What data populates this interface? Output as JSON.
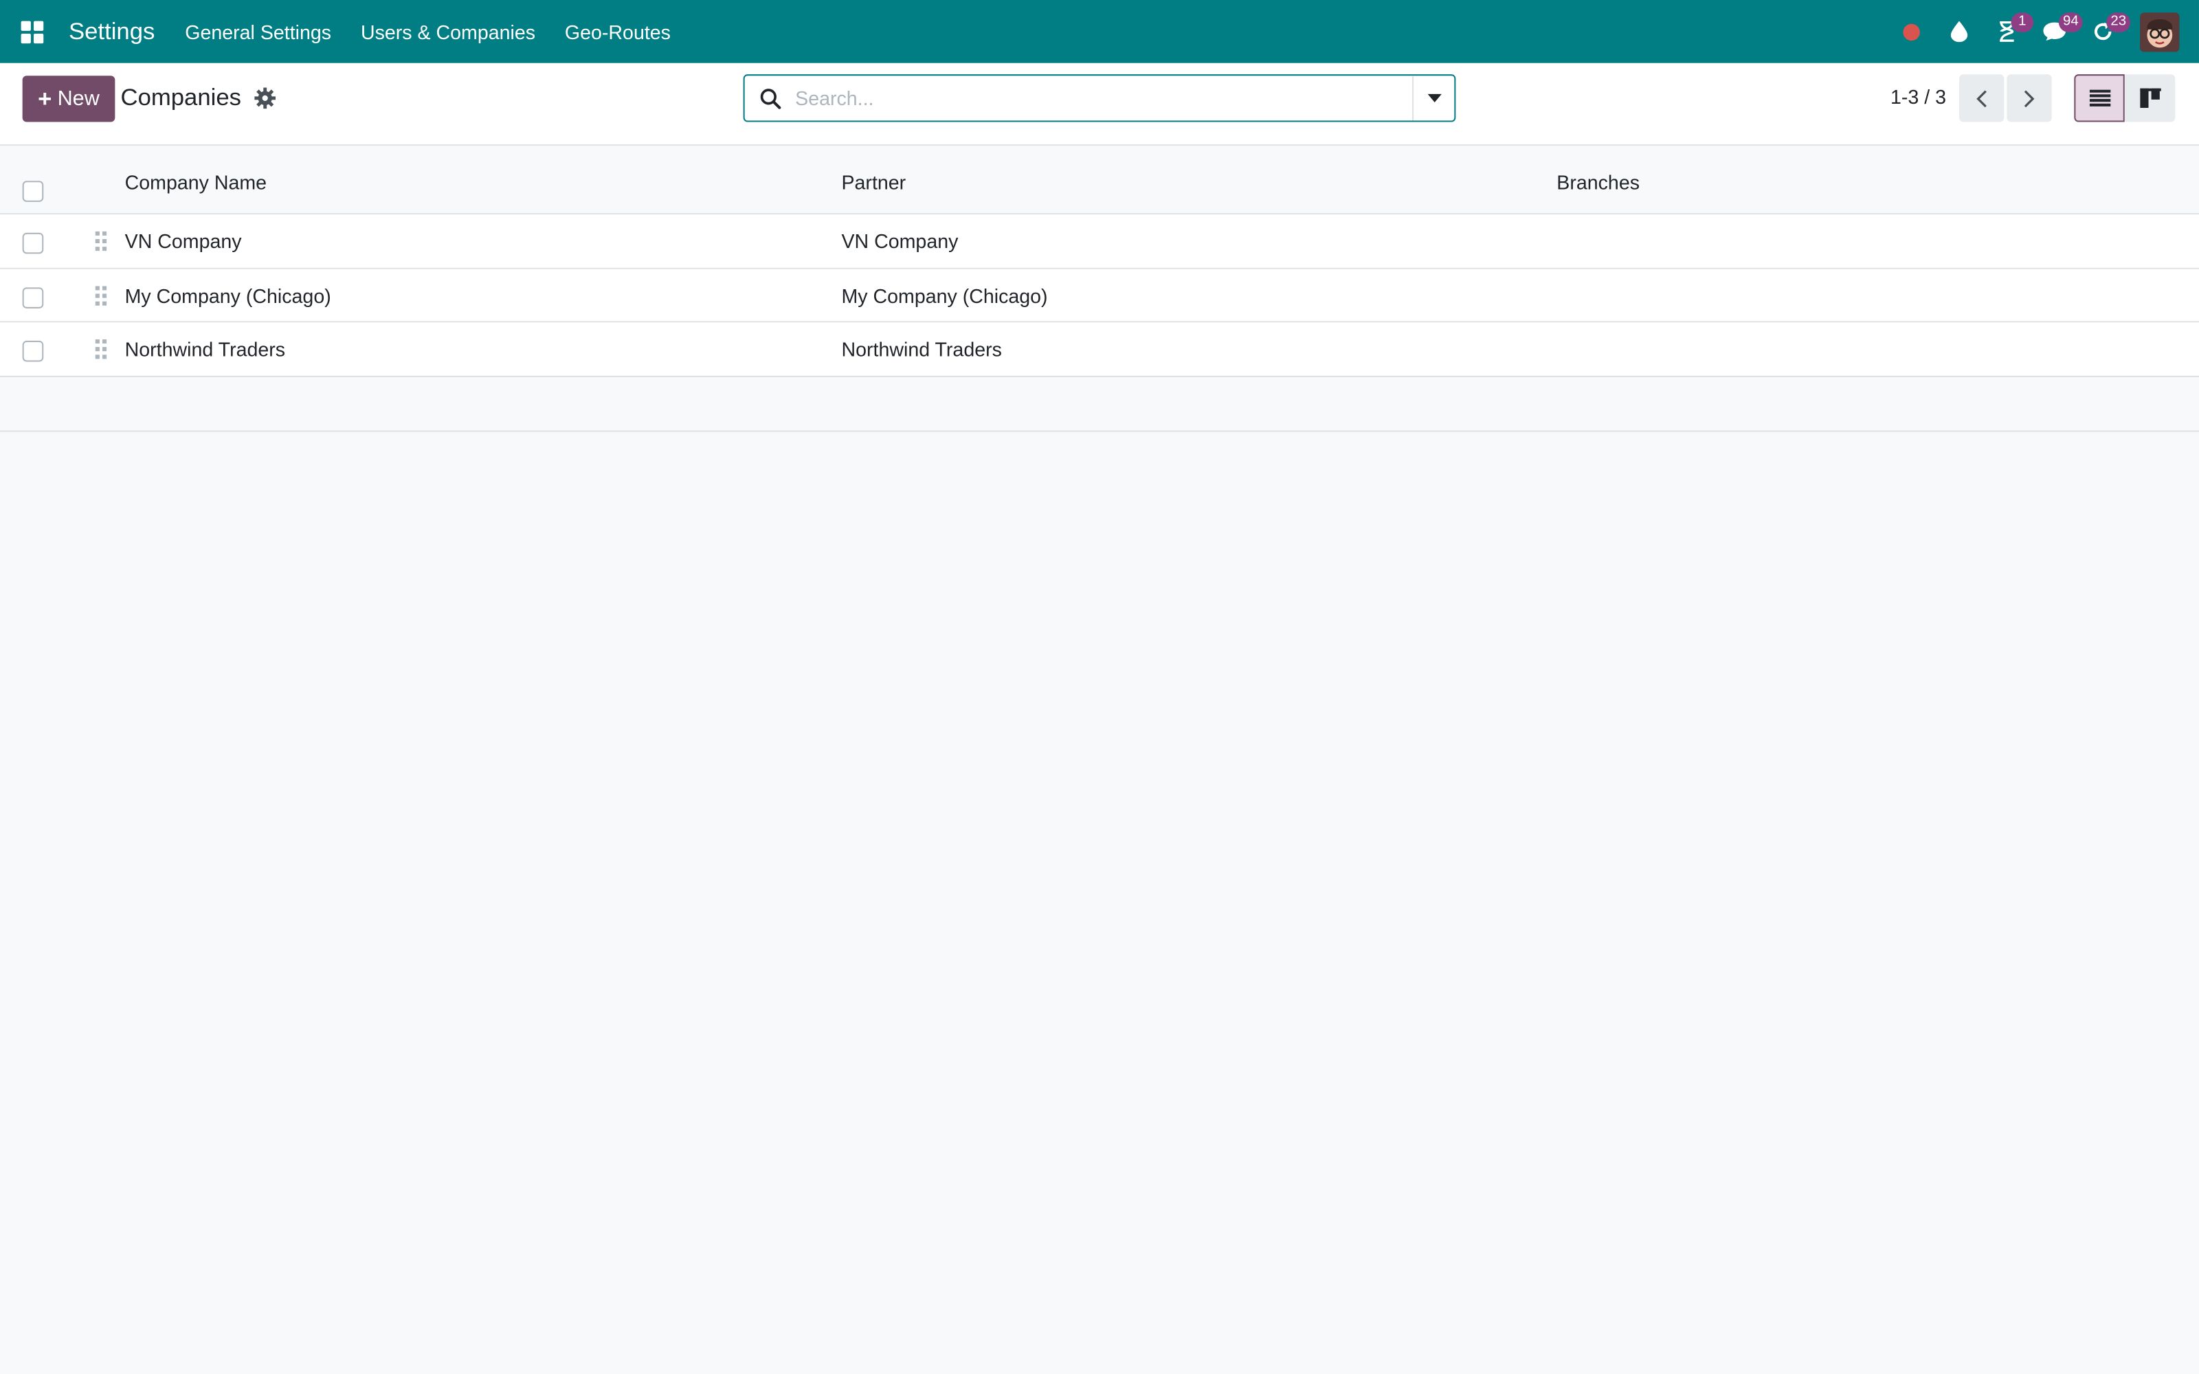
{
  "navbar": {
    "app_name": "Settings",
    "menu": [
      "General Settings",
      "Users & Companies",
      "Geo-Routes"
    ],
    "badges": {
      "activities": "1",
      "messages": "94",
      "updates": "23"
    }
  },
  "control": {
    "new_label": "New",
    "title": "Companies",
    "search_placeholder": "Search...",
    "pager": "1-3 / 3"
  },
  "table": {
    "columns": [
      "Company Name",
      "Partner",
      "Branches"
    ],
    "rows": [
      {
        "company": "VN Company",
        "partner": "VN Company",
        "branches": ""
      },
      {
        "company": "My Company (Chicago)",
        "partner": "My Company (Chicago)",
        "branches": ""
      },
      {
        "company": "Northwind Traders",
        "partner": "Northwind Traders",
        "branches": ""
      }
    ]
  },
  "colors": {
    "navbar": "#017e84",
    "primary": "#714b67",
    "badge": "#8f3e86"
  }
}
